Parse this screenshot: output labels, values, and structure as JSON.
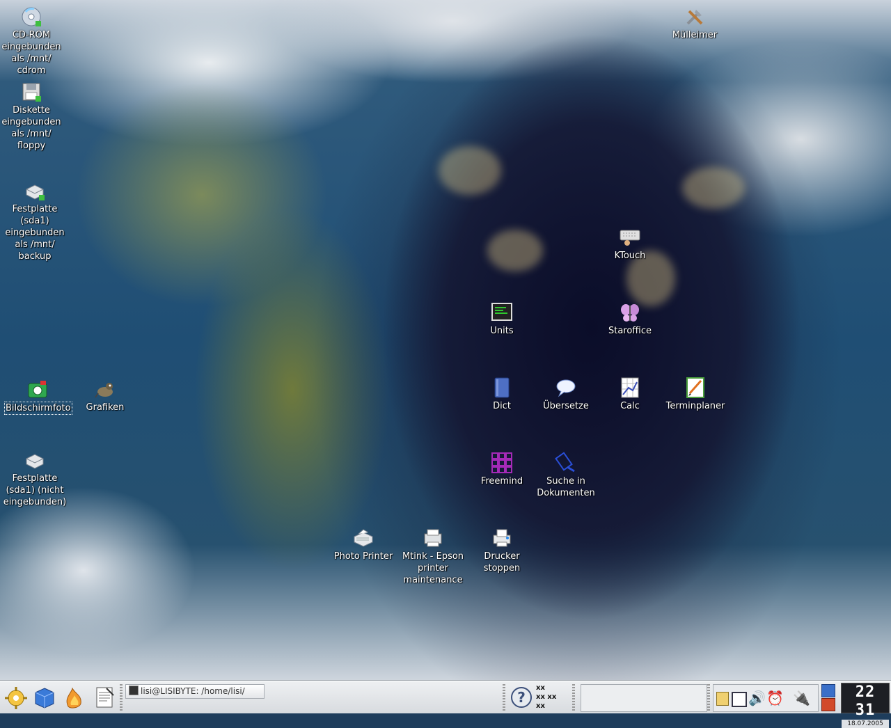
{
  "desktop": {
    "icons": {
      "cdrom": "CD-ROM\neingebunden\nals /mnt/\ncdrom",
      "floppy": "Diskette\neingebunden\nals /mnt/\nfloppy",
      "hdd_backup": "Festplatte\n(sda1)\neingebunden\nals /mnt/\nbackup",
      "screenshot": "Bildschirmfoto",
      "grafiken": "Grafiken",
      "hdd_unmounted": "Festplatte\n(sda1) (nicht\neingebunden)",
      "trash": "Mülleimer",
      "ktouch": "KTouch",
      "units": "Units",
      "staroffice": "Staroffice",
      "dict": "Dict",
      "uebersetze": "Übersetze",
      "calc": "Calc",
      "terminplaner": "Terminplaner",
      "freemind": "Freemind",
      "suche": "Suche in\nDokumenten",
      "photo_printer": "Photo Printer",
      "mtink": "Mtink - Epson\nprinter\nmaintenance",
      "drucker_stoppen": "Drucker\nstoppen"
    }
  },
  "taskbar": {
    "task_window_title": "lisi@LISIBYTE: /home/lisi/",
    "pager": [
      "xx",
      "xx xx",
      "xx"
    ],
    "clock_time": "22 31",
    "clock_date": "18.07.2005"
  },
  "colors": {
    "taskbar_bg": "#e3e6e9",
    "desktop_text": "#ffffff"
  }
}
